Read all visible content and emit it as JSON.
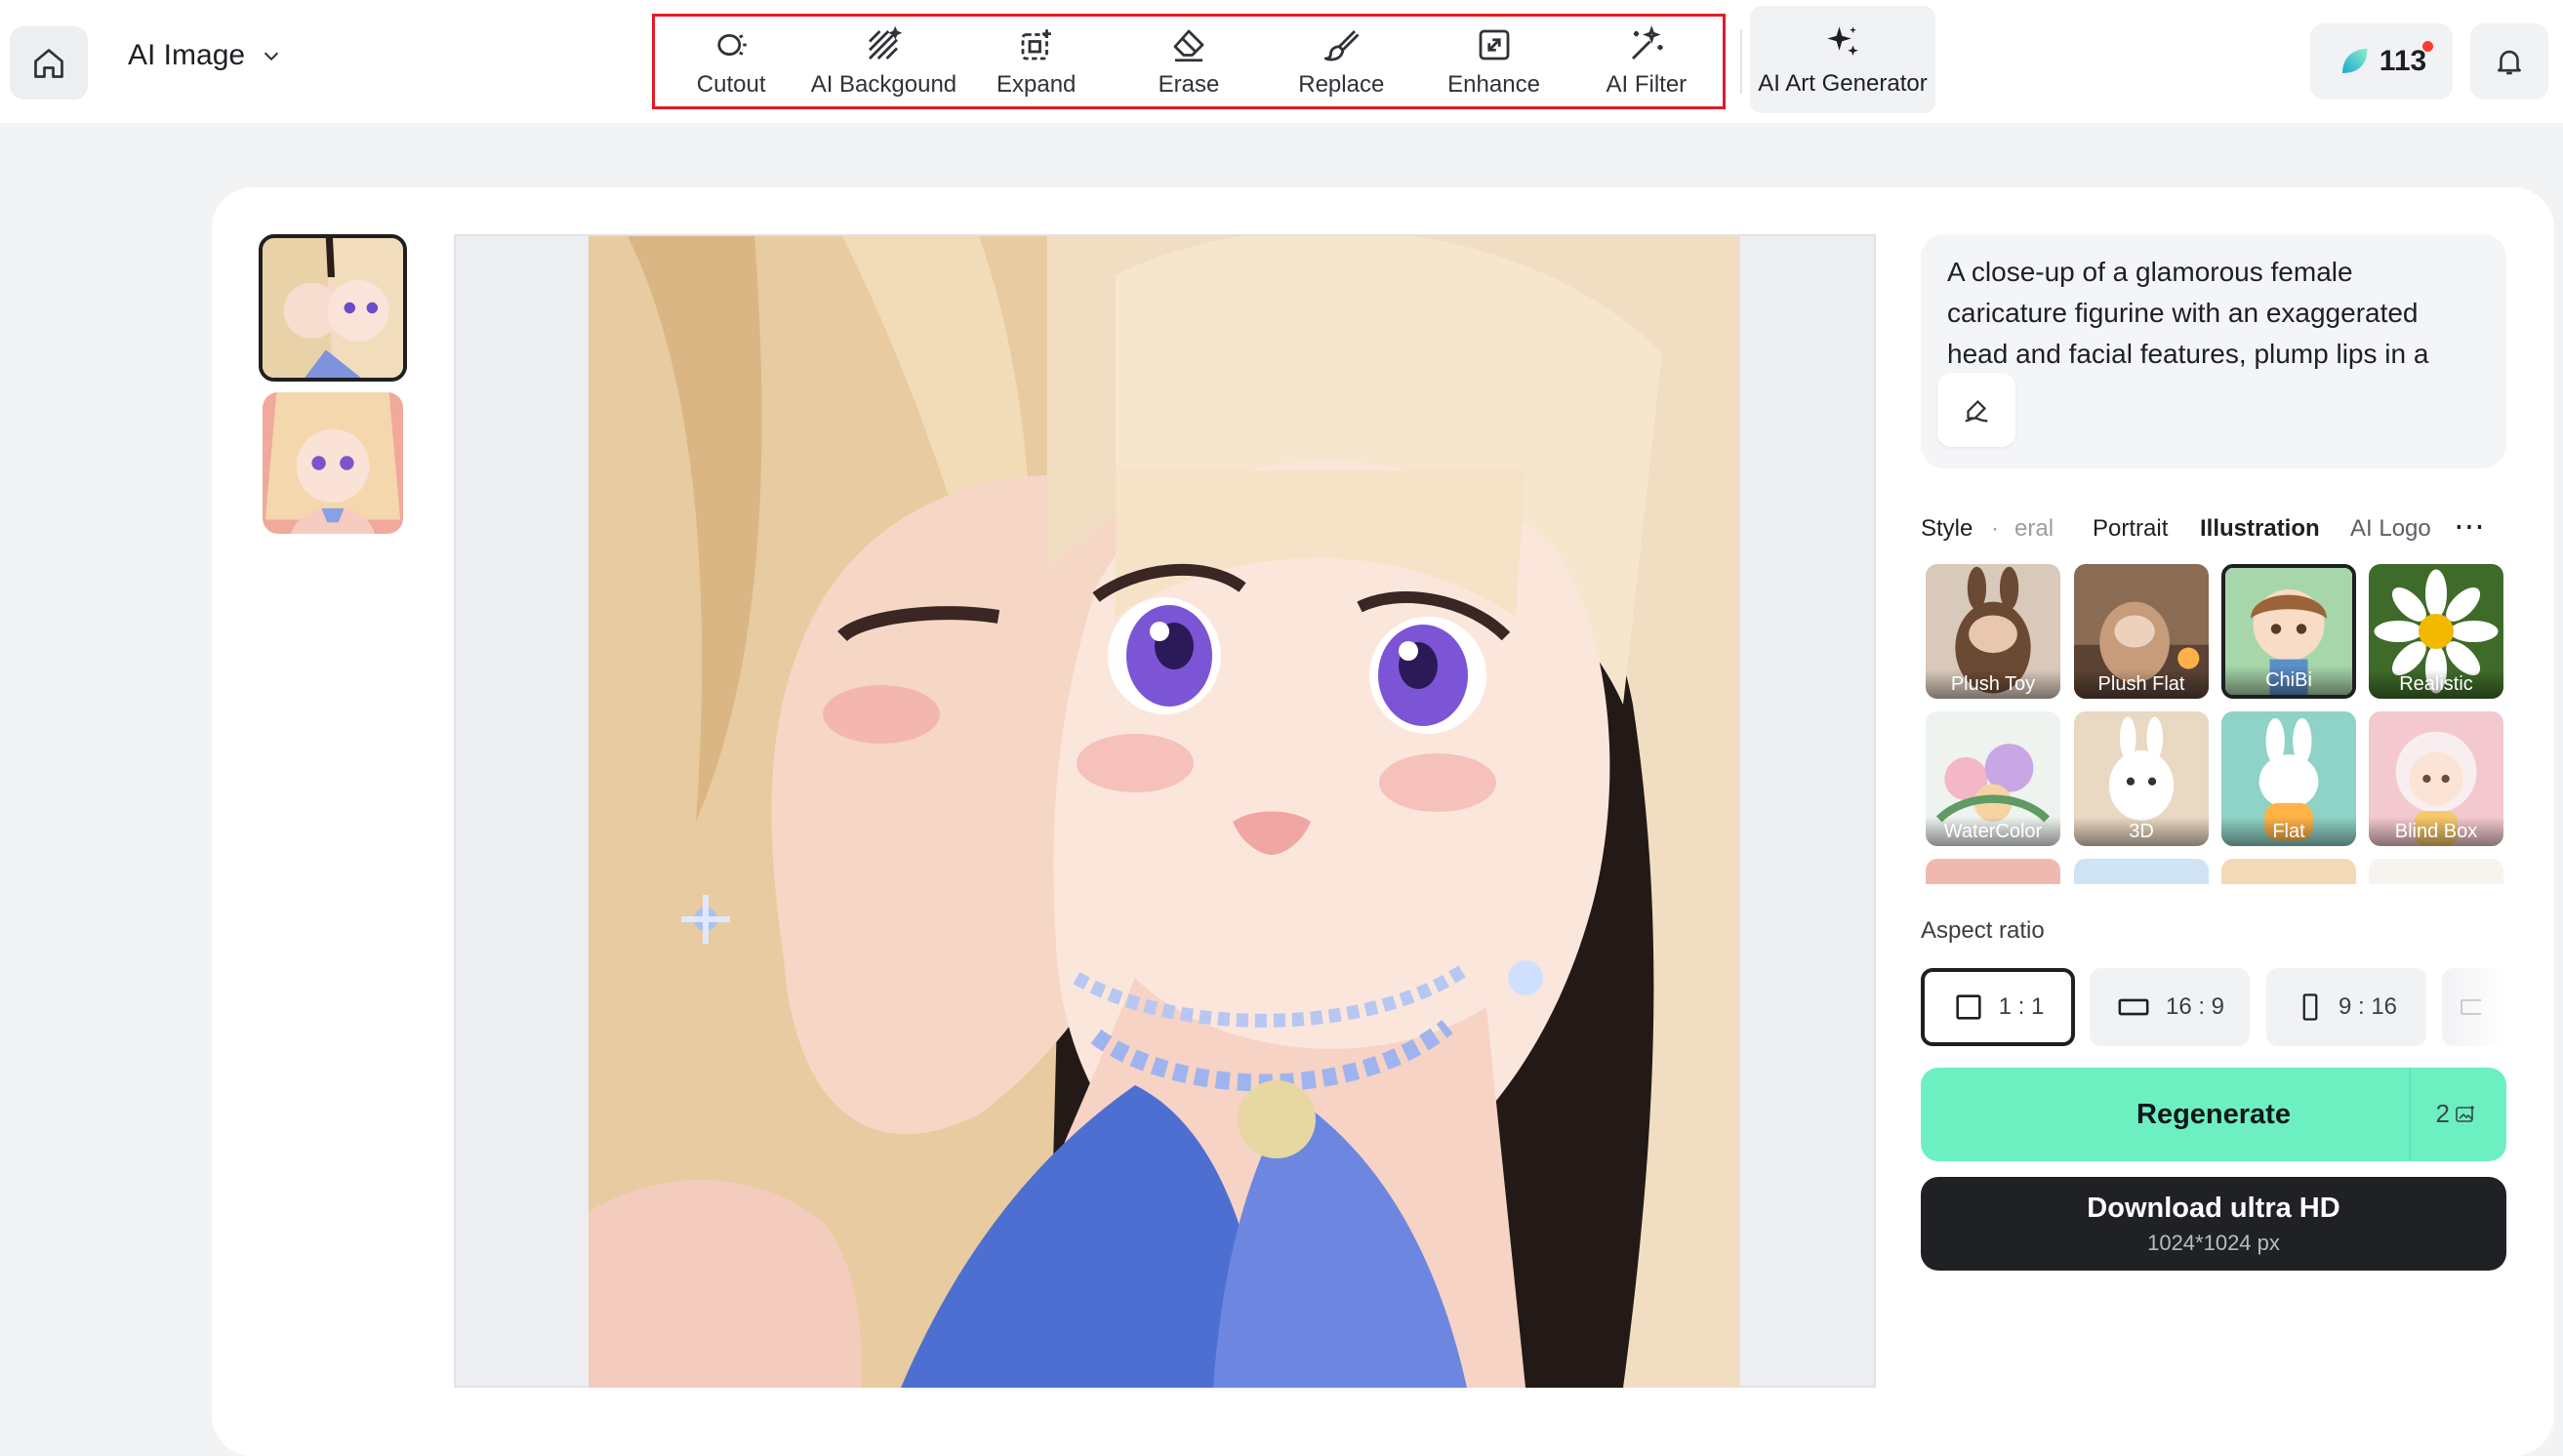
{
  "header": {
    "app_name": "AI Image",
    "tools": [
      {
        "label": "Cutout",
        "icon": "cutout-icon"
      },
      {
        "label": "AI Backgound",
        "icon": "ai-background-icon"
      },
      {
        "label": "Expand",
        "icon": "expand-icon"
      },
      {
        "label": "Erase",
        "icon": "eraser-icon"
      },
      {
        "label": "Replace",
        "icon": "brush-icon"
      },
      {
        "label": "Enhance",
        "icon": "enhance-icon"
      },
      {
        "label": "AI Filter",
        "icon": "magic-wand-icon"
      }
    ],
    "art_generator_label": "AI Art Generator",
    "credits": "113",
    "credits_icon": "leaf-gem-icon",
    "highlight_color": "#e01b24"
  },
  "prompt": {
    "text": "A close-up of a glamorous female caricature figurine with an exaggerated head and facial features, plump lips in a"
  },
  "styles": {
    "label": "Style",
    "tabs": [
      "General",
      "Portrait",
      "Illustration",
      "AI Logo"
    ],
    "visible_partial_tab": "eral",
    "active_tab": "Illustration",
    "more_icon": "more-horizontal-icon",
    "items": [
      {
        "label": "Plush Toy"
      },
      {
        "label": "Plush Flat"
      },
      {
        "label": "ChiBi",
        "selected": true
      },
      {
        "label": "Realistic"
      },
      {
        "label": "WaterColor"
      },
      {
        "label": "3D"
      },
      {
        "label": "Flat"
      },
      {
        "label": "Blind Box"
      }
    ]
  },
  "aspect": {
    "title": "Aspect ratio",
    "options": [
      {
        "label": "1 : 1",
        "selected": true
      },
      {
        "label": "16 : 9"
      },
      {
        "label": "9 : 16"
      }
    ]
  },
  "actions": {
    "regenerate_label": "Regenerate",
    "regenerate_cost": "2",
    "download_label": "Download ultra HD",
    "download_size": "1024*1024 px"
  },
  "colors": {
    "accent": "#6cf0c2",
    "dark_button": "#1f2125",
    "background": "#f2f3f5"
  }
}
